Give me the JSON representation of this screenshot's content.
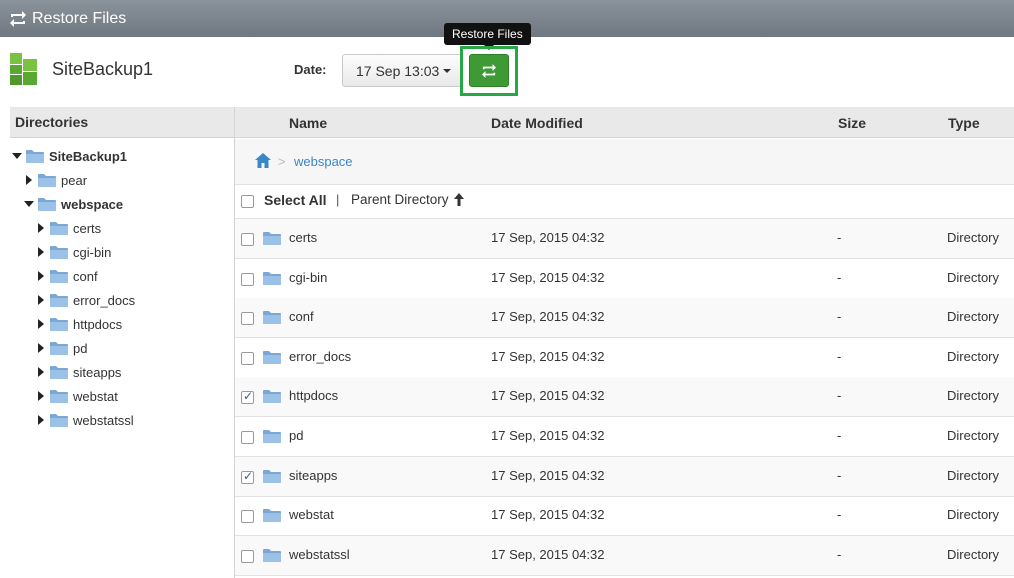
{
  "app": {
    "title": "Restore Files"
  },
  "site": {
    "name": "SiteBackup1"
  },
  "toolbar": {
    "date_label": "Date:",
    "date_value": "17 Sep 13:03",
    "restore_tooltip": "Restore Files"
  },
  "left": {
    "header": "Directories",
    "tree": [
      {
        "label": "SiteBackup1",
        "expanded": true,
        "bold": true,
        "level": 0
      },
      {
        "label": "pear",
        "expanded": false,
        "bold": false,
        "level": 1
      },
      {
        "label": "webspace",
        "expanded": true,
        "bold": true,
        "level": 1
      },
      {
        "label": "certs",
        "expanded": false,
        "bold": false,
        "level": 2
      },
      {
        "label": "cgi-bin",
        "expanded": false,
        "bold": false,
        "level": 2
      },
      {
        "label": "conf",
        "expanded": false,
        "bold": false,
        "level": 2
      },
      {
        "label": "error_docs",
        "expanded": false,
        "bold": false,
        "level": 2
      },
      {
        "label": "httpdocs",
        "expanded": false,
        "bold": false,
        "level": 2
      },
      {
        "label": "pd",
        "expanded": false,
        "bold": false,
        "level": 2
      },
      {
        "label": "siteapps",
        "expanded": false,
        "bold": false,
        "level": 2
      },
      {
        "label": "webstat",
        "expanded": false,
        "bold": false,
        "level": 2
      },
      {
        "label": "webstatssl",
        "expanded": false,
        "bold": false,
        "level": 2
      }
    ]
  },
  "grid": {
    "columns": {
      "name": "Name",
      "date": "Date Modified",
      "size": "Size",
      "type": "Type"
    },
    "breadcrumb": {
      "separator": ">",
      "current": "webspace"
    },
    "select_all": "Select All",
    "separator": "|",
    "parent_directory": "Parent Directory",
    "rows": [
      {
        "name": "certs",
        "date": "17 Sep, 2015 04:32",
        "size": "-",
        "type": "Directory",
        "checked": false
      },
      {
        "name": "cgi-bin",
        "date": "17 Sep, 2015 04:32",
        "size": "-",
        "type": "Directory",
        "checked": false
      },
      {
        "name": "conf",
        "date": "17 Sep, 2015 04:32",
        "size": "-",
        "type": "Directory",
        "checked": false
      },
      {
        "name": "error_docs",
        "date": "17 Sep, 2015 04:32",
        "size": "-",
        "type": "Directory",
        "checked": false
      },
      {
        "name": "httpdocs",
        "date": "17 Sep, 2015 04:32",
        "size": "-",
        "type": "Directory",
        "checked": true
      },
      {
        "name": "pd",
        "date": "17 Sep, 2015 04:32",
        "size": "-",
        "type": "Directory",
        "checked": false
      },
      {
        "name": "siteapps",
        "date": "17 Sep, 2015 04:32",
        "size": "-",
        "type": "Directory",
        "checked": true
      },
      {
        "name": "webstat",
        "date": "17 Sep, 2015 04:32",
        "size": "-",
        "type": "Directory",
        "checked": false
      },
      {
        "name": "webstatssl",
        "date": "17 Sep, 2015 04:32",
        "size": "-",
        "type": "Directory",
        "checked": false
      }
    ]
  },
  "colors": {
    "accent": "#3d9a35",
    "highlight": "#27a745",
    "link": "#3a87c8",
    "folder": "#7aa7d6"
  }
}
